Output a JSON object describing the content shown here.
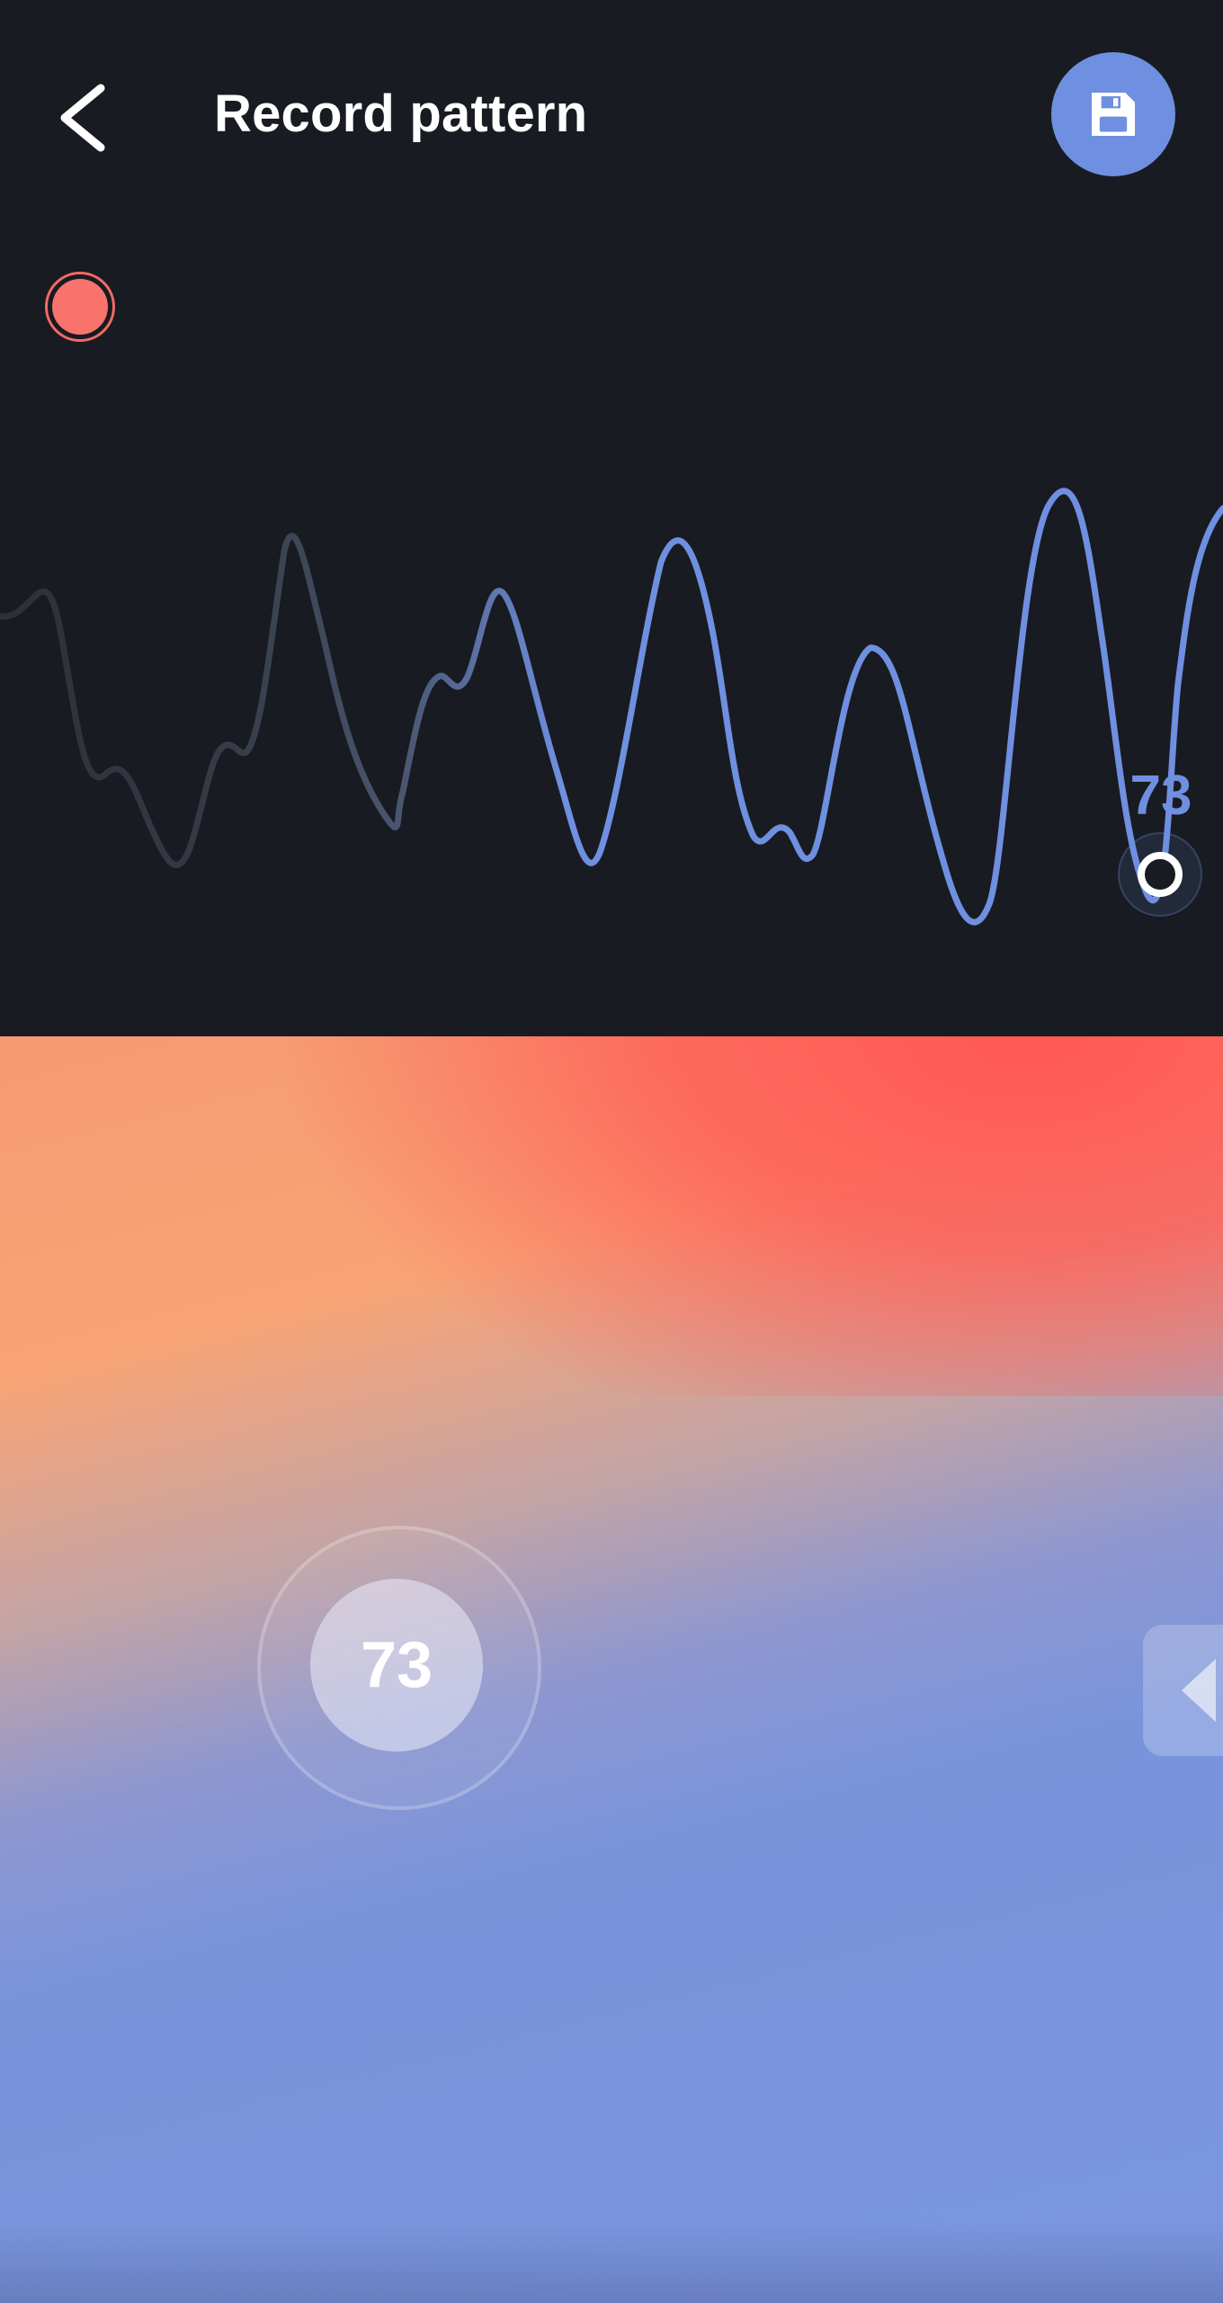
{
  "header": {
    "title": "Record pattern",
    "back_icon": "chevron-left-icon",
    "save_icon": "floppy-disk-icon"
  },
  "recording": {
    "state": "recording",
    "color": "#f8736c"
  },
  "waveform": {
    "current_value": "73",
    "line_color": "#6f8fe0",
    "faded_color": "#3a3f4b"
  },
  "pad": {
    "value": "73",
    "side_tab_icon": "triangle-left-icon"
  },
  "colors": {
    "background": "#181b21",
    "accent": "#6f8fe0",
    "record": "#f8736c"
  }
}
